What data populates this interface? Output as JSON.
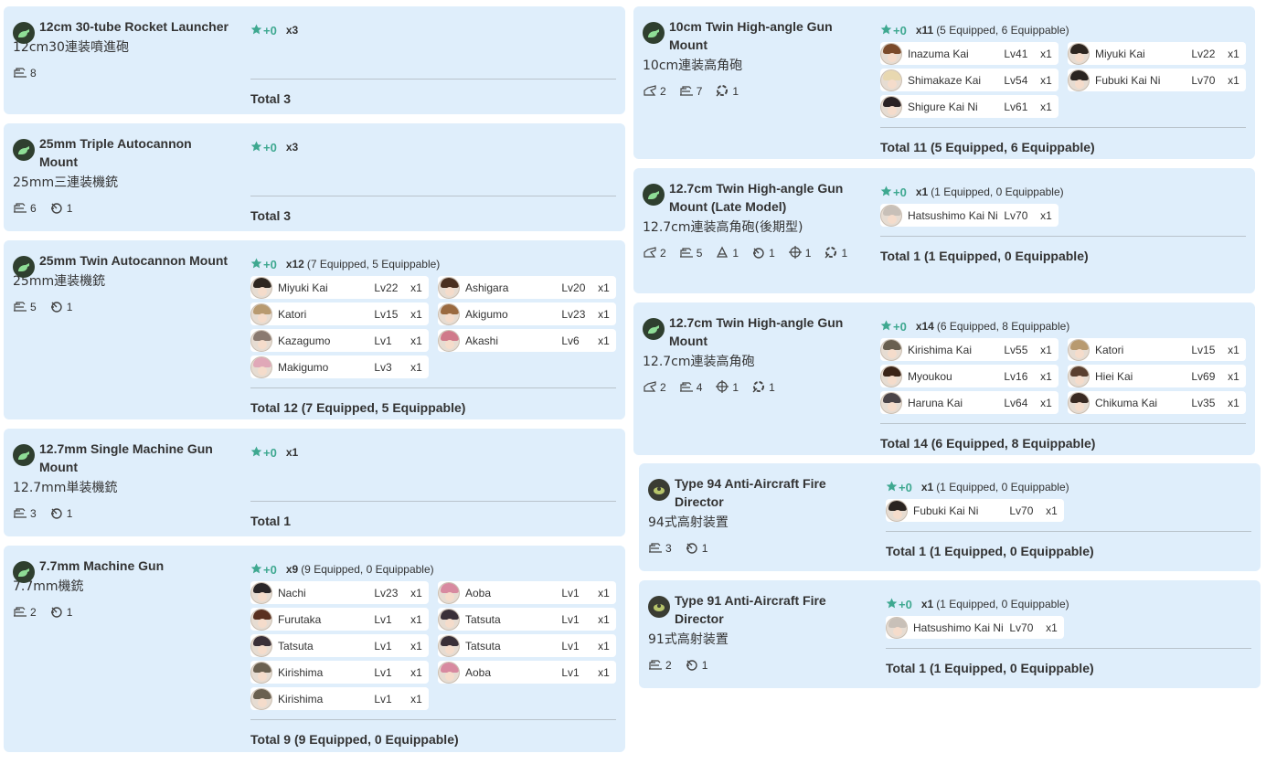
{
  "cards": [
    {
      "name": "12cm 30-tube Rocket Launcher",
      "jp": "12cm30連装噴進砲",
      "stats": [
        {
          "icon": "aa-icon",
          "value": "8"
        }
      ],
      "star": "+0",
      "count": "x3",
      "count_detail": "",
      "ships": [],
      "total": "Total 3"
    },
    {
      "name": "25mm Triple Autocannon Mount",
      "jp": "25mm三連装機銃",
      "stats": [
        {
          "icon": "aa-icon",
          "value": "6"
        },
        {
          "icon": "evasion-icon",
          "value": "1"
        }
      ],
      "star": "+0",
      "count": "x3",
      "count_detail": "",
      "ships": [],
      "total": "Total 3"
    },
    {
      "name": "25mm Twin Autocannon Mount",
      "jp": "25mm連装機銃",
      "stats": [
        {
          "icon": "aa-icon",
          "value": "5"
        },
        {
          "icon": "evasion-icon",
          "value": "1"
        }
      ],
      "star": "+0",
      "count": "x12",
      "count_detail": "(7 Equipped, 5 Equippable)",
      "ships": [
        {
          "name": "Miyuki Kai",
          "lv": "Lv22",
          "x": "x1",
          "hair": "#2e2620"
        },
        {
          "name": "Ashigara",
          "lv": "Lv20",
          "x": "x1",
          "hair": "#4a3020"
        },
        {
          "name": "Katori",
          "lv": "Lv15",
          "x": "x1",
          "hair": "#b89a70"
        },
        {
          "name": "Akigumo",
          "lv": "Lv23",
          "x": "x1",
          "hair": "#9a6a40"
        },
        {
          "name": "Kazagumo",
          "lv": "Lv1",
          "x": "x1",
          "hair": "#8a7a70"
        },
        {
          "name": "Akashi",
          "lv": "Lv6",
          "x": "x1",
          "hair": "#d07a8a"
        },
        {
          "name": "Makigumo",
          "lv": "Lv3",
          "x": "x1",
          "hair": "#e0a8b8"
        }
      ],
      "total": "Total 12 (7 Equipped, 5 Equippable)"
    },
    {
      "name": "12.7mm Single Machine Gun Mount",
      "jp": "12.7mm単装機銃",
      "stats": [
        {
          "icon": "aa-icon",
          "value": "3"
        },
        {
          "icon": "evasion-icon",
          "value": "1"
        }
      ],
      "star": "+0",
      "count": "x1",
      "count_detail": "",
      "ships": [],
      "total": "Total 1"
    },
    {
      "name": "7.7mm Machine Gun",
      "jp": "7.7mm機銃",
      "stats": [
        {
          "icon": "aa-icon",
          "value": "2"
        },
        {
          "icon": "evasion-icon",
          "value": "1"
        }
      ],
      "star": "+0",
      "count": "x9",
      "count_detail": "(9 Equipped, 0 Equippable)",
      "ships": [
        {
          "name": "Nachi",
          "lv": "Lv23",
          "x": "x1",
          "hair": "#2a2628"
        },
        {
          "name": "Aoba",
          "lv": "Lv1",
          "x": "x1",
          "hair": "#d88aa0"
        },
        {
          "name": "Furutaka",
          "lv": "Lv1",
          "x": "x1",
          "hair": "#5a3020"
        },
        {
          "name": "Tatsuta",
          "lv": "Lv1",
          "x": "x1",
          "hair": "#3a3038"
        },
        {
          "name": "Tatsuta",
          "lv": "Lv1",
          "x": "x1",
          "hair": "#3a3038"
        },
        {
          "name": "Tatsuta",
          "lv": "Lv1",
          "x": "x1",
          "hair": "#3a3038"
        },
        {
          "name": "Kirishima",
          "lv": "Lv1",
          "x": "x1",
          "hair": "#6a6050"
        },
        {
          "name": "Aoba",
          "lv": "Lv1",
          "x": "x1",
          "hair": "#d88aa0"
        },
        {
          "name": "Kirishima",
          "lv": "Lv1",
          "x": "x1",
          "hair": "#6a6050"
        }
      ],
      "total": "Total 9 (9 Equipped, 0 Equippable)"
    },
    {
      "name": "10cm Twin High-angle Gun Mount",
      "jp": "10cm連装高角砲",
      "stats": [
        {
          "icon": "firepower-icon",
          "value": "2"
        },
        {
          "icon": "aa-icon",
          "value": "7"
        },
        {
          "icon": "antiair-hit-icon",
          "value": "1"
        }
      ],
      "star": "+0",
      "count": "x11",
      "count_detail": "(5 Equipped, 6 Equippable)",
      "ships": [
        {
          "name": "Inazuma Kai",
          "lv": "Lv41",
          "x": "x1",
          "hair": "#7a4a2a"
        },
        {
          "name": "Miyuki Kai",
          "lv": "Lv22",
          "x": "x1",
          "hair": "#2e2620"
        },
        {
          "name": "Shimakaze Kai",
          "lv": "Lv54",
          "x": "x1",
          "hair": "#e8d8b0"
        },
        {
          "name": "Fubuki Kai Ni",
          "lv": "Lv70",
          "x": "x1",
          "hair": "#2a2420"
        },
        {
          "name": "Shigure Kai Ni",
          "lv": "Lv61",
          "x": "x1",
          "hair": "#2a2224"
        }
      ],
      "total": "Total 11 (5 Equipped, 6 Equippable)"
    },
    {
      "name": "12.7cm Twin High-angle Gun Mount (Late Model)",
      "jp": "12.7cm連装高角砲(後期型)",
      "stats": [
        {
          "icon": "firepower-icon",
          "value": "2"
        },
        {
          "icon": "aa-icon",
          "value": "5"
        },
        {
          "icon": "asw-icon",
          "value": "1"
        },
        {
          "icon": "evasion-icon",
          "value": "1"
        },
        {
          "icon": "accuracy-icon",
          "value": "1"
        },
        {
          "icon": "antiair-hit-icon",
          "value": "1"
        }
      ],
      "star": "+0",
      "count": "x1",
      "count_detail": "(1 Equipped, 0 Equippable)",
      "ships": [
        {
          "name": "Hatsushimo Kai Ni",
          "lv": "Lv70",
          "x": "x1",
          "hair": "#c8c0b8"
        }
      ],
      "total": "Total 1 (1 Equipped, 0 Equippable)"
    },
    {
      "name": "12.7cm Twin High-angle Gun Mount",
      "jp": "12.7cm連装高角砲",
      "stats": [
        {
          "icon": "firepower-icon",
          "value": "2"
        },
        {
          "icon": "aa-icon",
          "value": "4"
        },
        {
          "icon": "accuracy-icon",
          "value": "1"
        },
        {
          "icon": "antiair-hit-icon",
          "value": "1"
        }
      ],
      "star": "+0",
      "count": "x14",
      "count_detail": "(6 Equipped, 8 Equippable)",
      "ships": [
        {
          "name": "Kirishima Kai",
          "lv": "Lv55",
          "x": "x1",
          "hair": "#6a6050"
        },
        {
          "name": "Katori",
          "lv": "Lv15",
          "x": "x1",
          "hair": "#b89a70"
        },
        {
          "name": "Myoukou",
          "lv": "Lv16",
          "x": "x1",
          "hair": "#3a2418"
        },
        {
          "name": "Hiei Kai",
          "lv": "Lv69",
          "x": "x1",
          "hair": "#5a4030"
        },
        {
          "name": "Haruna Kai",
          "lv": "Lv64",
          "x": "x1",
          "hair": "#4a4448"
        },
        {
          "name": "Chikuma Kai",
          "lv": "Lv35",
          "x": "x1",
          "hair": "#3a2a22"
        }
      ],
      "total": "Total 14 (6 Equipped, 8 Equippable)"
    },
    {
      "name": "Type 94 Anti-Aircraft Fire Director",
      "jp": "94式高射装置",
      "stats": [
        {
          "icon": "aa-icon",
          "value": "3"
        },
        {
          "icon": "evasion-icon",
          "value": "1"
        }
      ],
      "star": "+0",
      "count": "x1",
      "count_detail": "(1 Equipped, 0 Equippable)",
      "ships": [
        {
          "name": "Fubuki Kai Ni",
          "lv": "Lv70",
          "x": "x1",
          "hair": "#2a2420"
        }
      ],
      "total": "Total 1 (1 Equipped, 0 Equippable)"
    },
    {
      "name": "Type 91 Anti-Aircraft Fire Director",
      "jp": "91式高射装置",
      "stats": [
        {
          "icon": "aa-icon",
          "value": "2"
        },
        {
          "icon": "evasion-icon",
          "value": "1"
        }
      ],
      "star": "+0",
      "count": "x1",
      "count_detail": "(1 Equipped, 0 Equippable)",
      "ships": [
        {
          "name": "Hatsushimo Kai Ni",
          "lv": "Lv70",
          "x": "x1",
          "hair": "#c8c0b8"
        }
      ],
      "total": "Total 1 (1 Equipped, 0 Equippable)"
    }
  ]
}
